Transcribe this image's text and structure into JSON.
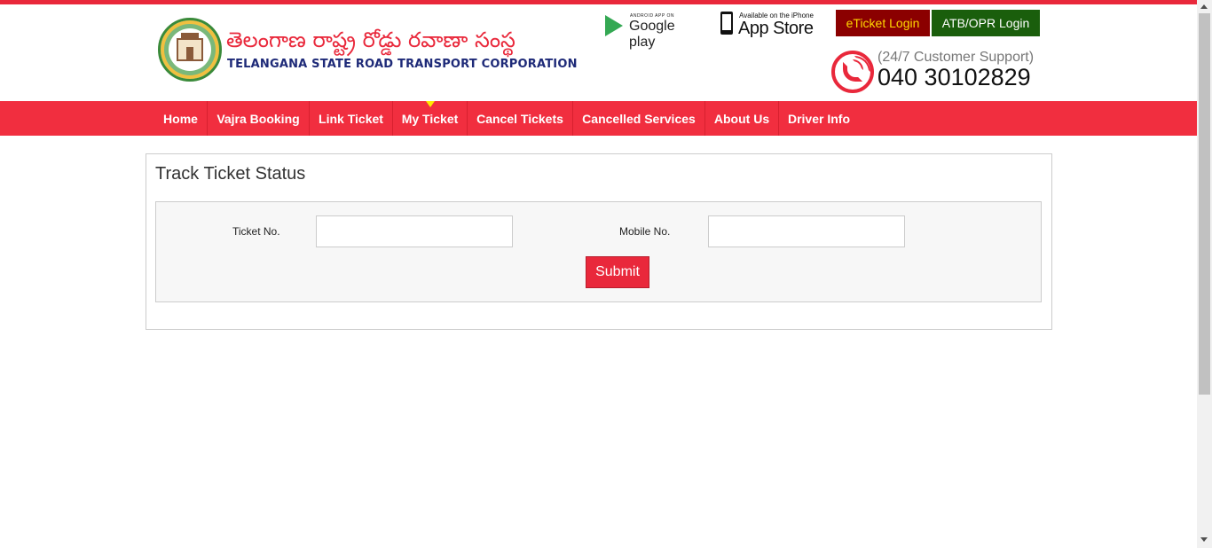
{
  "brand": {
    "telugu_name": "తెలంగాణ  రాష్ట్ర రోడ్డు రవాణా సంస్థ",
    "english_name": "TELANGANA STATE ROAD TRANSPORT CORPORATION",
    "logo_icon": "tsrtc-seal-icon"
  },
  "apps": {
    "google_play_small": "ANDROID APP ON",
    "google_play_label": "Google play",
    "app_store_small": "Available on the iPhone",
    "app_store_label": "App Store"
  },
  "login": {
    "eticket_label": "eTicket Login",
    "atb_label": "ATB/OPR Login"
  },
  "support": {
    "label": "(24/7 Customer Support)",
    "number": "040 30102829"
  },
  "nav": {
    "items": [
      {
        "label": "Home"
      },
      {
        "label": "Vajra Booking"
      },
      {
        "label": "Link Ticket"
      },
      {
        "label": "My Ticket"
      },
      {
        "label": "Cancel Tickets"
      },
      {
        "label": "Cancelled Services"
      },
      {
        "label": "About Us"
      },
      {
        "label": "Driver Info"
      }
    ],
    "active": "My Ticket"
  },
  "track": {
    "title": "Track Ticket Status",
    "ticket_label": "Ticket No.",
    "ticket_value": "",
    "mobile_label": "Mobile No.",
    "mobile_value": "",
    "submit_label": "Submit"
  },
  "colors": {
    "accent": "#e9283b",
    "eticket_bg": "#8b0000",
    "atb_bg": "#1a5e0c"
  }
}
